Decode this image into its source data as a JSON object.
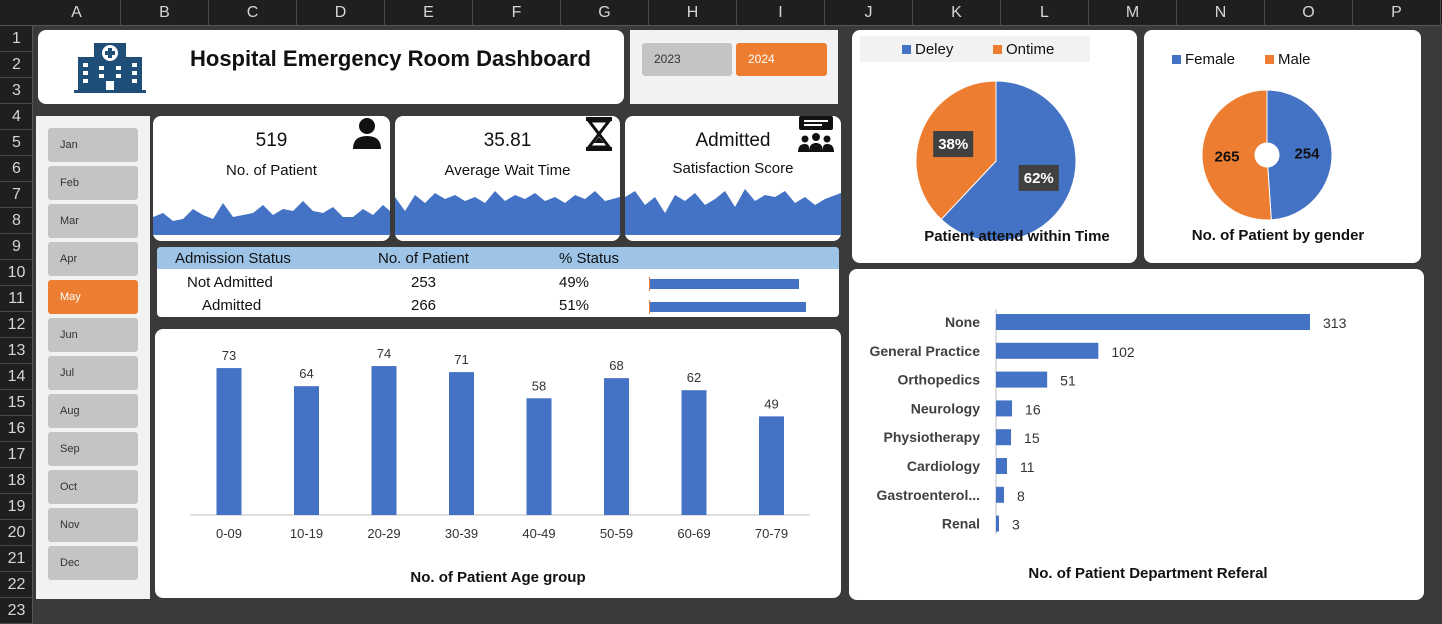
{
  "spreadsheet": {
    "columns": [
      "A",
      "B",
      "C",
      "D",
      "E",
      "F",
      "G",
      "H",
      "I",
      "J",
      "K",
      "L",
      "M",
      "N",
      "O",
      "P"
    ],
    "rows": [
      "1",
      "2",
      "3",
      "4",
      "5",
      "6",
      "7",
      "8",
      "9",
      "10",
      "11",
      "12",
      "13",
      "14",
      "15",
      "16",
      "17",
      "18",
      "19",
      "20",
      "21",
      "22",
      "23"
    ]
  },
  "dashboard": {
    "title": "Hospital Emergency Room Dashboard",
    "years": [
      {
        "label": "2023",
        "active": false
      },
      {
        "label": "2024",
        "active": true
      }
    ],
    "months": [
      {
        "label": "Jan",
        "active": false
      },
      {
        "label": "Feb",
        "active": false
      },
      {
        "label": "Mar",
        "active": false
      },
      {
        "label": "Apr",
        "active": false
      },
      {
        "label": "May",
        "active": true
      },
      {
        "label": "Jun",
        "active": false
      },
      {
        "label": "Jul",
        "active": false
      },
      {
        "label": "Aug",
        "active": false
      },
      {
        "label": "Sep",
        "active": false
      },
      {
        "label": "Oct",
        "active": false
      },
      {
        "label": "Nov",
        "active": false
      },
      {
        "label": "Dec",
        "active": false
      }
    ]
  },
  "kpis": [
    {
      "value": "519",
      "label": "No. of Patient",
      "icon": "patient-icon"
    },
    {
      "value": "35.81",
      "label": "Average Wait Time",
      "icon": "hourglass-icon"
    },
    {
      "value": "Admitted",
      "label": "Satisfaction Score",
      "icon": "group-chat-icon"
    }
  ],
  "admission": {
    "headers": [
      "Admission Status",
      "No. of Patient",
      "% Status"
    ],
    "rows": [
      {
        "status": "Not Admitted",
        "count": "253",
        "pct": "49%",
        "fraction": 0.49
      },
      {
        "status": "Admitted",
        "count": "266",
        "pct": "51%",
        "fraction": 0.51
      }
    ]
  },
  "colors": {
    "blue": "#4472c4",
    "orange": "#ed7d31",
    "header_blue": "#9dc3e6"
  },
  "chart_data": [
    {
      "type": "pie",
      "title": "Patient attend within Time",
      "legend": [
        "Deley",
        "Ontime"
      ],
      "legend_position": "top",
      "slices": [
        {
          "name": "Deley",
          "value": 62,
          "label": "62%"
        },
        {
          "name": "Ontime",
          "value": 38,
          "label": "38%"
        }
      ]
    },
    {
      "type": "pie",
      "title": "No. of Patient by gender",
      "legend": [
        "Female",
        "Male"
      ],
      "legend_position": "top",
      "slices": [
        {
          "name": "Female",
          "value": 254,
          "label": "254"
        },
        {
          "name": "Male",
          "value": 265,
          "label": "265"
        }
      ]
    },
    {
      "type": "bar",
      "title": "No. of Patient Age group",
      "categories": [
        "0-09",
        "10-19",
        "20-29",
        "30-39",
        "40-49",
        "50-59",
        "60-69",
        "70-79"
      ],
      "values": [
        73,
        64,
        74,
        71,
        58,
        68,
        62,
        49
      ]
    },
    {
      "type": "bar",
      "orientation": "horizontal",
      "title": "No. of Patient Department Referal",
      "categories": [
        "None",
        "General Practice",
        "Orthopedics",
        "Neurology",
        "Physiotherapy",
        "Cardiology",
        "Gastroenterol...",
        "Renal"
      ],
      "values": [
        313,
        102,
        51,
        16,
        15,
        11,
        8,
        3
      ]
    }
  ]
}
